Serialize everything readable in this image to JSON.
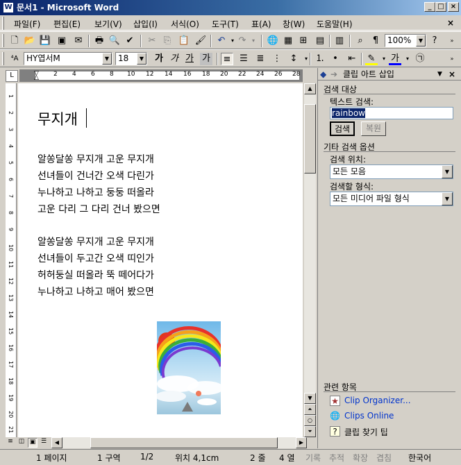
{
  "window": {
    "title": "문서1 - Microsoft Word"
  },
  "menu": [
    "파일(F)",
    "편집(E)",
    "보기(V)",
    "삽입(I)",
    "서식(O)",
    "도구(T)",
    "표(A)",
    "창(W)",
    "도움말(H)"
  ],
  "toolbar": {
    "zoom": "100%",
    "font": "HY엽서M",
    "size": "18"
  },
  "ruler": {
    "h_ticks": [
      "2",
      "4",
      "6",
      "8",
      "10",
      "12",
      "14",
      "16",
      "18",
      "20",
      "22",
      "24",
      "26",
      "28"
    ],
    "v_ticks": [
      "1",
      "2",
      "3",
      "4",
      "5",
      "6",
      "7",
      "8",
      "9",
      "10",
      "11",
      "12",
      "13",
      "14",
      "15",
      "16",
      "17",
      "18",
      "19",
      "20",
      "21"
    ]
  },
  "document": {
    "title": "무지개",
    "stanza1": [
      "알쏭달쏭 무지개 고운 무지개",
      "선녀들이 건너간 오색 다린가",
      "누나하고 나하고 둥둥 떠올라",
      "고운 다리 그 다리 건너 봤으면"
    ],
    "stanza2": [
      "알쏭달쏭 무지개 고운 무지개",
      "선녀들이 두고간 오색 띠인가",
      "허허둥실 떠올라 뚝 떼어다가",
      "누나하고 나하고 매어 봤으면"
    ]
  },
  "status": {
    "page": "1 페이지",
    "section": "1 구역",
    "pages": "1/2",
    "pos": "위치 4,1cm",
    "line": "2 줄",
    "col": "4 열",
    "rec": "기록",
    "trk": "추적",
    "ext": "확장",
    "ovr": "겹침",
    "lang": "한국어"
  },
  "pane": {
    "title": "클립 아트 삽입",
    "search_section": "검색 대상",
    "text_search_label": "텍스트 검색:",
    "search_value": "rainbow",
    "search_button": "검색",
    "restore_button": "복원",
    "other_options": "기타 검색 옵션",
    "search_in_label": "검색 위치:",
    "search_in_value": "모든 모음",
    "result_type_label": "검색할 형식:",
    "result_type_value": "모든 미디어 파일 형식",
    "related": "관련 항목",
    "link1": "Clip Organizer...",
    "link2": "Clips Online",
    "link3": "클립 찾기 팁"
  }
}
